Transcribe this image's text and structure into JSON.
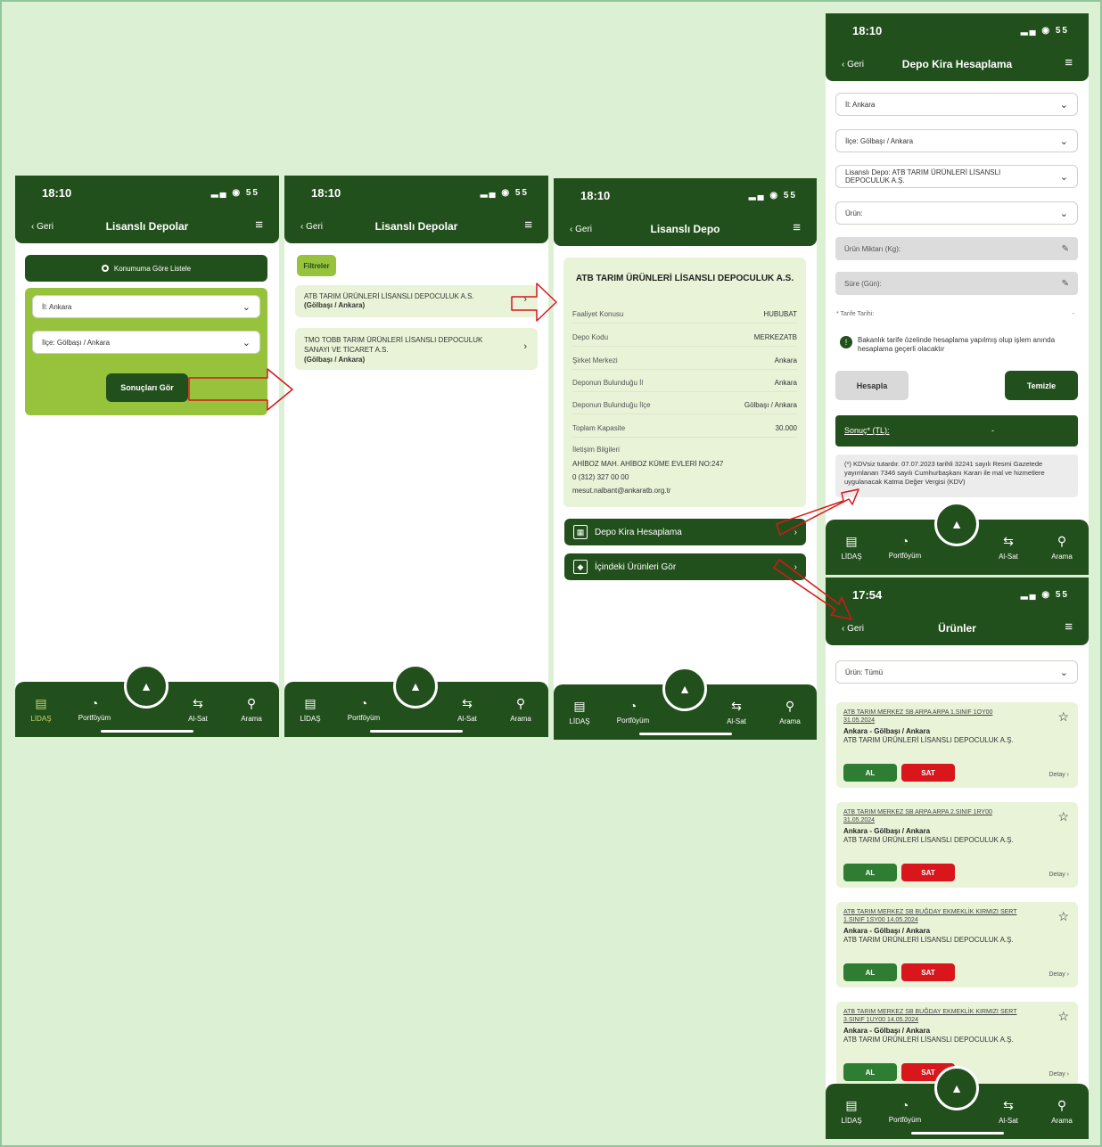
{
  "common": {
    "time": "18:10",
    "time_urunler": "17:54",
    "status": "▂▄ ◉ 55",
    "back": "‹ Geri",
    "menu": "≡"
  },
  "nav": {
    "lidas": "LİDAŞ",
    "portfoy": "Portföyüm",
    "alsat": "Al-Sat",
    "arama": "Arama",
    "icons": {
      "lidas": "bar-chart-icon",
      "portfoy": "pie-chart-icon",
      "center": "logo-icon",
      "alsat": "swap-icon",
      "arama": "search-icon"
    }
  },
  "screen1": {
    "title": "Lisanslı Depolar",
    "location_button": "Konumuma Göre Listele",
    "il_select": "İl: Ankara",
    "ilce_select": "İlçe: Gölbaşı / Ankara",
    "results_button": "Sonuçları Gör"
  },
  "screen2": {
    "title": "Lisanslı Depolar",
    "filter": "Filtreler",
    "items": [
      {
        "name": "ATB TARIM ÜRÜNLERİ LİSANSLI DEPOCULUK A.S.",
        "loc": "(Gölbaşı / Ankara)"
      },
      {
        "name": "TMO TOBB TARIM ÜRÜNLERİ LİSANSLI DEPOCULUK SANAYI VE TİCARET A.S.",
        "loc": "(Gölbaşı / Ankara)"
      }
    ]
  },
  "screen3": {
    "title": "Lisanslı Depo",
    "company": "ATB TARIM ÜRÜNLERİ LİSANSLI DEPOCULUK A.S.",
    "rows": [
      {
        "label": "Faaliyet Konusu",
        "value": "HUBUBAT"
      },
      {
        "label": "Depo Kodu",
        "value": "MERKEZATB"
      },
      {
        "label": "Şirket Merkezi",
        "value": "Ankara"
      },
      {
        "label": "Deponun Bulunduğu İl",
        "value": "Ankara"
      },
      {
        "label": "Deponun Bulunduğu İlçe",
        "value": "Gölbaşı / Ankara"
      },
      {
        "label": "Toplam Kapasite",
        "value": "30.000"
      }
    ],
    "contact_label": "İletişim Bilgileri",
    "address": "AHİBOZ MAH. AHİBOZ KÜME EVLERİ NO:247",
    "phone": "0 (312) 327 00 00",
    "email": "mesut.nalbant@ankaratb.org.tr",
    "btn_kira": "Depo Kira Hesaplama",
    "btn_urunler": "İçindeki Ürünleri Gör"
  },
  "screen4": {
    "title": "Depo Kira Hesaplama",
    "il": "İl: Ankara",
    "ilce": "İlçe: Gölbaşı / Ankara",
    "depo": "Lisanslı Depo: ATB TARIM ÜRÜNLERİ LİSANSLI DEPOCULUK A.Ş.",
    "urun": "Ürün:",
    "miktar": "Ürün Miktarı (Kg):",
    "sure": "Süre (Gün):",
    "tarife": "* Tarife Tarihi:",
    "tarife_value": "-",
    "info": "Bakanlık tarife özelinde hesaplama yapılmış olup işlem anında hesaplama geçerli olacaktır",
    "btn_hesapla": "Hesapla",
    "btn_temizle": "Temizle",
    "sonuc_label": "Sonuç* (TL):",
    "sonuc_value": "-",
    "note": "(*) KDVsiz tutardır. 07.07.2023 tarihli 32241 sayılı Resmi Gazetede yayımlanan 7346 sayılı Cumhurbaşkanı Kararı ile mal ve hizmetlere uygulanacak Katma Değer Vergisi (KDV)"
  },
  "screen5": {
    "title": "Ürünler",
    "filter": "Ürün: Tümü",
    "buy": "AL",
    "sell": "SAT",
    "detail": "Detay ›",
    "products": [
      {
        "code": "ATB TARIM MERKEZ SB ARPA ARPA 1.SINIF 1OY00 31.05.2024",
        "loc": "Ankara - Gölbaşı / Ankara",
        "company": "ATB TARIM ÜRÜNLERİ LİSANSLI DEPOCULUK A.Ş."
      },
      {
        "code": "ATB TARIM MERKEZ SB ARPA ARPA 2.SINIF 1RY00 31.05.2024",
        "loc": "Ankara - Gölbaşı / Ankara",
        "company": "ATB TARIM ÜRÜNLERİ LİSANSLI DEPOCULUK A.Ş."
      },
      {
        "code": "ATB TARIM MERKEZ SB BUĞDAY EKMEKLİK KIRMIZI SERT 1.SINIF 1SY00 14.05.2024",
        "loc": "Ankara - Gölbaşı / Ankara",
        "company": "ATB TARIM ÜRÜNLERİ LİSANSLI DEPOCULUK A.Ş."
      },
      {
        "code": "ATB TARIM MERKEZ SB BUĞDAY EKMEKLİK KIRMIZI SERT 3.SINIF 1UY00 14.05.2024",
        "loc": "Ankara - Gölbaşı / Ankara",
        "company": "ATB TARIM ÜRÜNLERİ LİSANSLI DEPOCULUK A.Ş."
      }
    ]
  },
  "colors": {
    "primary": "#22501c",
    "accent": "#97c23c",
    "card": "#e8f3d8",
    "buy": "#2e7d32",
    "sell": "#d8161b",
    "arrow": "#d8161b"
  }
}
